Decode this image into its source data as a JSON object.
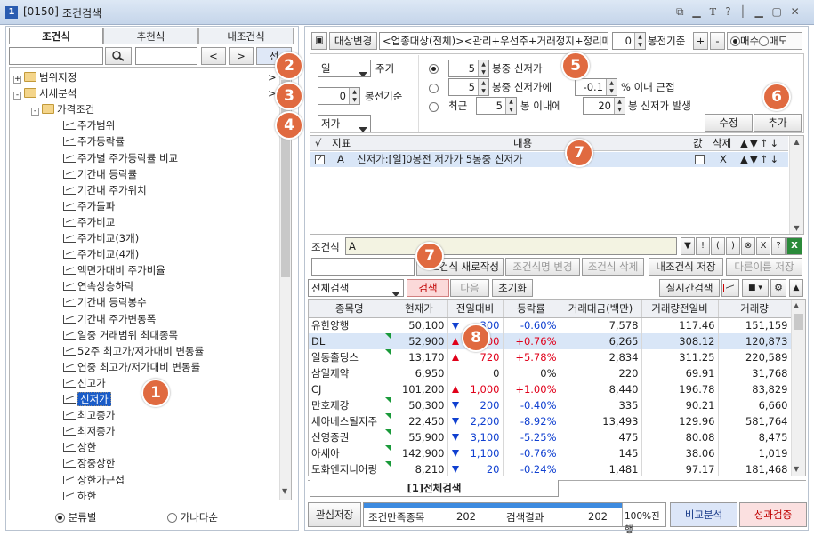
{
  "window": {
    "number": "1",
    "code": "[0150]",
    "title": "조건검색",
    "controls": "⧉ ▁ 𝐓 ? │ ▁ ▢ ✕"
  },
  "left": {
    "tabs": [
      "조건식",
      "추천식",
      "내조건식"
    ],
    "prev": "<",
    "next": ">",
    "all": "전",
    "tree": [
      {
        "label": "범위지정",
        "type": "folder",
        "sign": "+",
        "arrow": ">"
      },
      {
        "label": "시세분석",
        "type": "folder",
        "sign": "-",
        "arrow": ">"
      },
      {
        "label": "가격조건",
        "type": "folder2",
        "sign": "-"
      },
      {
        "label": "주가범위"
      },
      {
        "label": "주가등락률"
      },
      {
        "label": "주가별 주가등락률 비교"
      },
      {
        "label": "기간내 등락률"
      },
      {
        "label": "기간내 주가위치"
      },
      {
        "label": "주가돌파"
      },
      {
        "label": "주가비교"
      },
      {
        "label": "주가비교(3개)"
      },
      {
        "label": "주가비교(4개)"
      },
      {
        "label": "액면가대비 주가비율"
      },
      {
        "label": "연속상승하락"
      },
      {
        "label": "기간내 등락봉수"
      },
      {
        "label": "기간내 주가변동폭"
      },
      {
        "label": "일중 거래범위 최대종목"
      },
      {
        "label": "52주 최고가/저가대비 변동률"
      },
      {
        "label": "연중 최고가/저가대비 변동률"
      },
      {
        "label": "신고가"
      },
      {
        "label": "신저가",
        "selected": true
      },
      {
        "label": "최고종가"
      },
      {
        "label": "최저종가"
      },
      {
        "label": "상한"
      },
      {
        "label": "장중상한"
      },
      {
        "label": "상한가근접"
      },
      {
        "label": "하한"
      }
    ],
    "radio1": "분류별",
    "radio2": "가나다순"
  },
  "toolbar": {
    "target_change": "대상변경",
    "target_text": "<업종대상(전체)><관리+우선주+거래정지+정리매매",
    "bong_value": "0",
    "bong_label": "봉전기준",
    "plus": "+",
    "minus": "-",
    "buy": "매수",
    "sell": "매도"
  },
  "cond": {
    "period_value": "일",
    "period_label": "주기",
    "bong_value": "0",
    "bong_label": "봉전기준",
    "price_value": "저가",
    "line1_value": "5",
    "line1_text": "봉중 신저가",
    "line2_value": "5",
    "line2_text": "봉중 신저가에",
    "line2_pct": "-0.1",
    "line2_tail": "% 이내 근접",
    "line3_prefix": "최근",
    "line3_value": "5",
    "line3_mid": "봉 이내에",
    "line3_value2": "20",
    "line3_tail": "봉 신저가 발생",
    "modify": "수정",
    "add": "추가"
  },
  "condtable": {
    "headers": [
      "√",
      "지표",
      "내용",
      "값",
      "삭제",
      "▲▼↑↓"
    ],
    "row": {
      "id": "A",
      "content": "신저가:[일]0봉전 저가가 5봉중 신저가",
      "del": "X",
      "ctrl": "▲▼↑↓"
    }
  },
  "formula": {
    "label": "조건식",
    "value": "A",
    "btns": [
      "▼",
      "!",
      "(",
      ")",
      "⊗",
      "X",
      "?"
    ]
  },
  "actions": {
    "new": "조건식 새로작성",
    "rename": "조건식명 변경",
    "delete": "조건식 삭제",
    "save": "내조건식 저장",
    "saveas": "다른이름 저장"
  },
  "search": {
    "scope": "전체검색",
    "search": "검색",
    "next": "다음",
    "reset": "초기화",
    "realtime": "실시간검색"
  },
  "results": {
    "headers": [
      "종목명",
      "현재가",
      "전일대비",
      "등락률",
      "거래대금(백만)",
      "거래량전일비",
      "거래량"
    ],
    "rows": [
      {
        "name": "유한양행",
        "price": "50,100",
        "dir": "dn",
        "chg": "300",
        "rate": "-0.60%",
        "amt": "7,578",
        "vr": "117.46",
        "vol": "151,159",
        "flag": false
      },
      {
        "name": "DL",
        "price": "52,900",
        "dir": "up",
        "chg": "400",
        "rate": "+0.76%",
        "amt": "6,265",
        "vr": "308.12",
        "vol": "120,873",
        "flag": true,
        "sel": true
      },
      {
        "name": "일동홀딩스",
        "price": "13,170",
        "dir": "up",
        "chg": "720",
        "rate": "+5.78%",
        "amt": "2,834",
        "vr": "311.25",
        "vol": "220,589",
        "flag": true
      },
      {
        "name": "삼일제약",
        "price": "6,950",
        "dir": "",
        "chg": "0",
        "rate": "0%",
        "amt": "220",
        "vr": "69.91",
        "vol": "31,768",
        "flag": false
      },
      {
        "name": "CJ",
        "price": "101,200",
        "dir": "up",
        "chg": "1,000",
        "rate": "+1.00%",
        "amt": "8,440",
        "vr": "196.78",
        "vol": "83,829",
        "flag": false
      },
      {
        "name": "만호제강",
        "price": "50,300",
        "dir": "dn",
        "chg": "200",
        "rate": "-0.40%",
        "amt": "335",
        "vr": "90.21",
        "vol": "6,660",
        "flag": true
      },
      {
        "name": "세아베스틸지주",
        "price": "22,450",
        "dir": "dn",
        "chg": "2,200",
        "rate": "-8.92%",
        "amt": "13,493",
        "vr": "129.96",
        "vol": "581,764",
        "flag": true
      },
      {
        "name": "신영증권",
        "price": "55,900",
        "dir": "dn",
        "chg": "3,100",
        "rate": "-5.25%",
        "amt": "475",
        "vr": "80.08",
        "vol": "8,475",
        "flag": true
      },
      {
        "name": "아세아",
        "price": "142,900",
        "dir": "dn",
        "chg": "1,100",
        "rate": "-0.76%",
        "amt": "145",
        "vr": "38.06",
        "vol": "1,019",
        "flag": true
      },
      {
        "name": "도화엔지니어링",
        "price": "8,210",
        "dir": "dn",
        "chg": "20",
        "rate": "-0.24%",
        "amt": "1,481",
        "vr": "97.17",
        "vol": "181,468",
        "flag": true
      }
    ]
  },
  "bottom": {
    "tab": "[1]전체검색",
    "watch": "관심저장",
    "cond_count_label": "조건만족종목",
    "cond_count": "202",
    "result_label": "검색결과",
    "result_count": "202",
    "progress": "100%진행",
    "progress_value": 1.0,
    "compare": "비교분석",
    "verify": "성과검증"
  },
  "badges": [
    "1",
    "2",
    "3",
    "4",
    "5",
    "6",
    "7",
    "7",
    "8"
  ]
}
